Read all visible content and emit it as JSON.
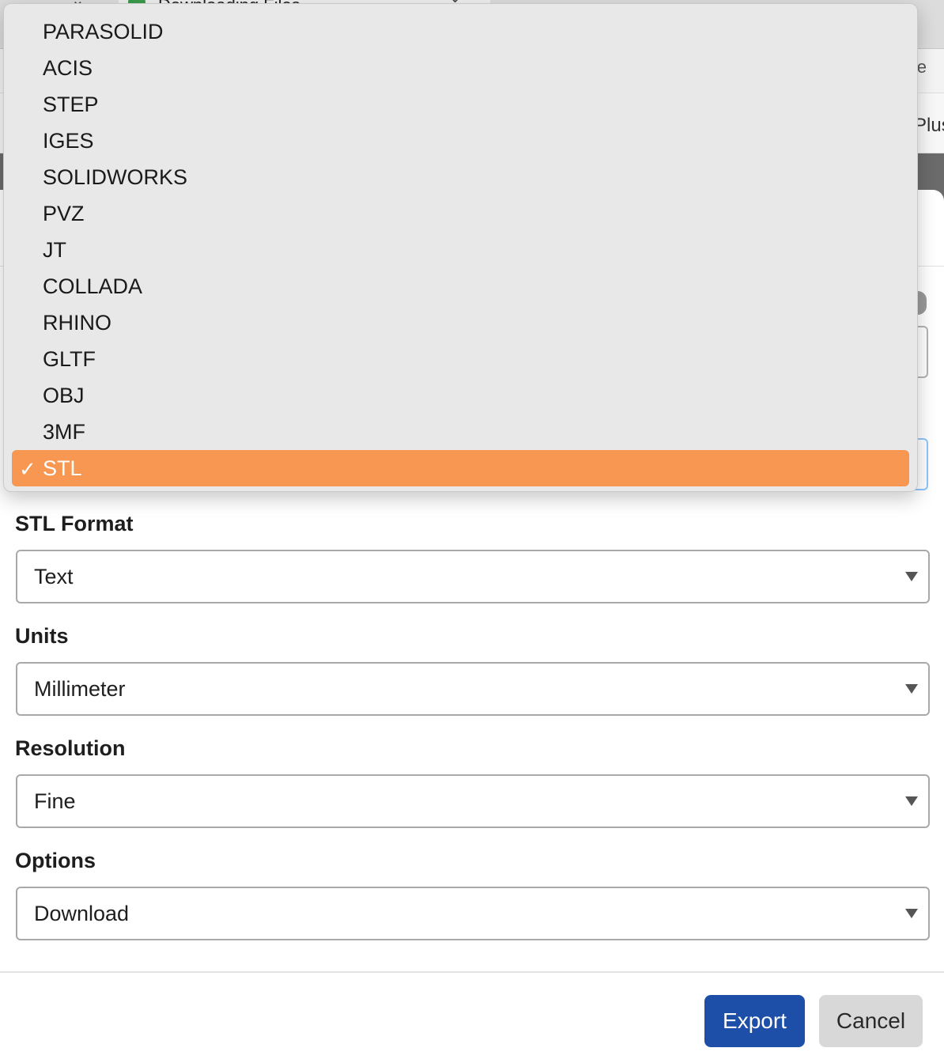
{
  "browser": {
    "tab_title": "Downloading Files",
    "address_suffix": "e",
    "bookmark_text": "Plus"
  },
  "format_dropdown": {
    "options": [
      "PARASOLID",
      "ACIS",
      "STEP",
      "IGES",
      "SOLIDWORKS",
      "PVZ",
      "JT",
      "COLLADA",
      "RHINO",
      "GLTF",
      "OBJ",
      "3MF",
      "STL"
    ],
    "selected": "STL",
    "check_glyph": "✓"
  },
  "fields": {
    "stl_format": {
      "label": "STL Format",
      "value": "Text"
    },
    "units": {
      "label": "Units",
      "value": "Millimeter"
    },
    "resolution": {
      "label": "Resolution",
      "value": "Fine"
    },
    "options": {
      "label": "Options",
      "value": "Download"
    }
  },
  "buttons": {
    "export": "Export",
    "cancel": "Cancel"
  },
  "colors": {
    "selected_highlight": "#f79751",
    "primary_button": "#1d4fa8",
    "secondary_button": "#d8d8d8"
  }
}
